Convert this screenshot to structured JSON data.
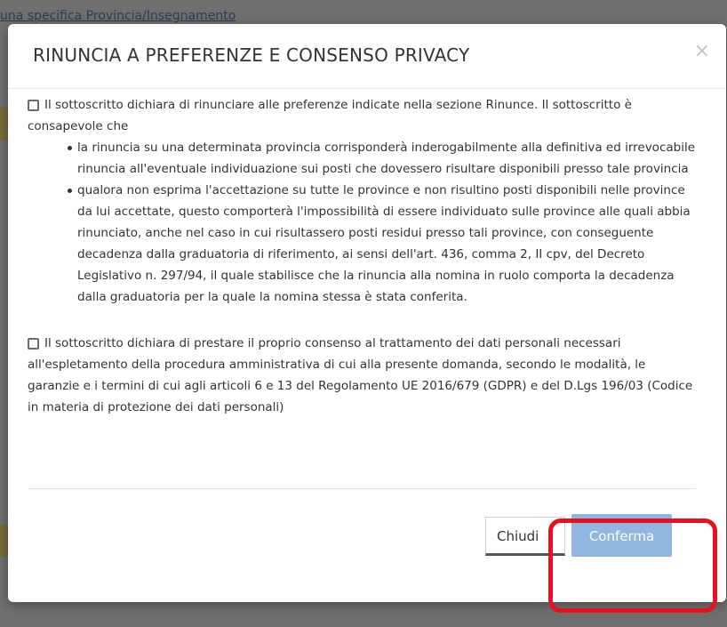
{
  "background": {
    "link_text": "una specifica Provincia/Insegnamento"
  },
  "modal": {
    "title": "RINUNCIA A PREFERENZE E CONSENSO PRIVACY",
    "close_symbol": "×",
    "waiver": {
      "intro": "Il sottoscritto dichiara di rinunciare alle preferenze indicate nella sezione Rinunce. Il sottoscritto è consapevole che",
      "bullets": [
        "la rinuncia su una determinata provincia corrisponderà inderogabilmente alla definitiva ed irrevocabile rinuncia all'eventuale individuazione sui posti che dovessero risultare disponibili presso tale provincia",
        "qualora non esprima l'accettazione su tutte le province e non risultino posti disponibili nelle province da lui accettate, questo comporterà l'impossibilità di essere individuato sulle province alle quali abbia rinunciato, anche nel caso in cui risultassero posti residui presso tali province, con conseguente decadenza dalla graduatoria di riferimento, ai sensi dell'art. 436, comma 2, II cpv, del Decreto Legislativo n. 297/94, il quale stabilisce che la rinuncia alla nomina in ruolo comporta la decadenza dalla graduatoria per la quale la nomina stessa è stata conferita."
      ],
      "checked": false
    },
    "privacy": {
      "text": "Il sottoscritto dichiara di prestare il proprio consenso al trattamento dei dati personali necessari all'espletamento della procedura amministrativa di cui alla presente domanda, secondo le modalità, le garanzie e i termini di cui agli articoli 6 e 13 del Regolamento UE 2016/679 (GDPR) e del D.Lgs 196/03 (Codice in materia di protezione dei dati personali)",
      "checked": false
    },
    "buttons": {
      "close_label": "Chiudi",
      "confirm_label": "Conferma"
    }
  },
  "colors": {
    "confirm_button": "#8fb7e2",
    "highlight": "#e8101d",
    "overlay": "#6f6f6f"
  }
}
